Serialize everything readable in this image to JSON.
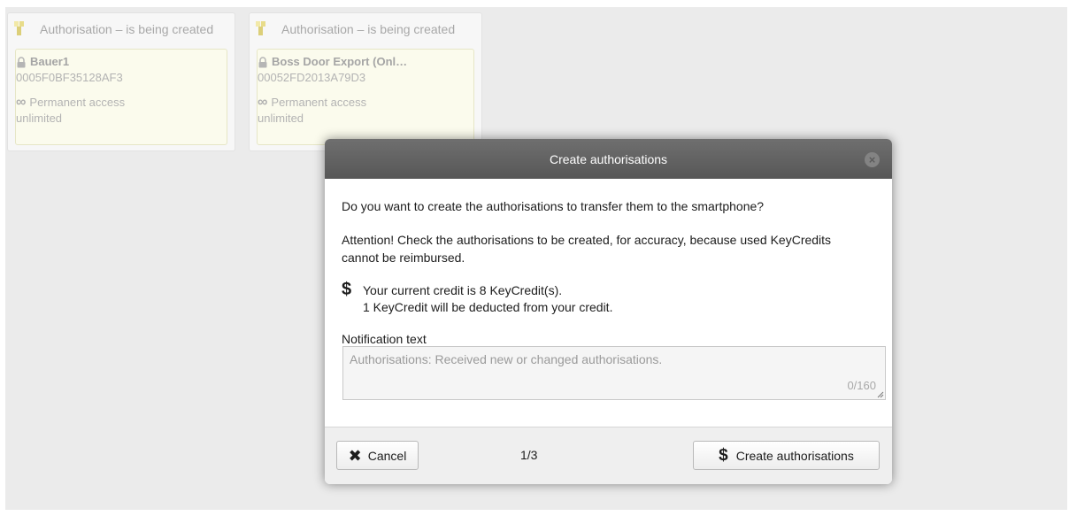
{
  "cards": [
    {
      "header": "Authorisation – is being created",
      "title": "Bauer1",
      "code": "0005F0BF35128AF3",
      "access": "Permanent access",
      "validity": "unlimited"
    },
    {
      "header": "Authorisation – is being created",
      "title": "Boss Door Export (Onl…",
      "code": "00052FD2013A79D3",
      "access": "Permanent access",
      "validity": "unlimited"
    }
  ],
  "dialog": {
    "title": "Create authorisations",
    "close_glyph": "×",
    "question": "Do you want to create the authorisations to transfer them to the smartphone?",
    "attention": "Attention! Check the authorisations to be created, for accuracy, because used KeyCredits cannot be reimbursed.",
    "credit_line1": "Your current credit is 8 KeyCredit(s).",
    "credit_line2": "1 KeyCredit will be deducted from your credit.",
    "notification_label": "Notification text",
    "notification_placeholder": "Authorisations: Received new or changed authorisations.",
    "char_count": "0/160",
    "cancel_label": "Cancel",
    "pager": "1/3",
    "create_label": "Create authorisations"
  },
  "icons": {
    "dollar": "$",
    "cancel": "✖",
    "infinity": "∞"
  },
  "colors": {
    "dialog_header": "#5f5f5f",
    "card_body": "#fbfbed",
    "page_background": "#ebebeb"
  }
}
